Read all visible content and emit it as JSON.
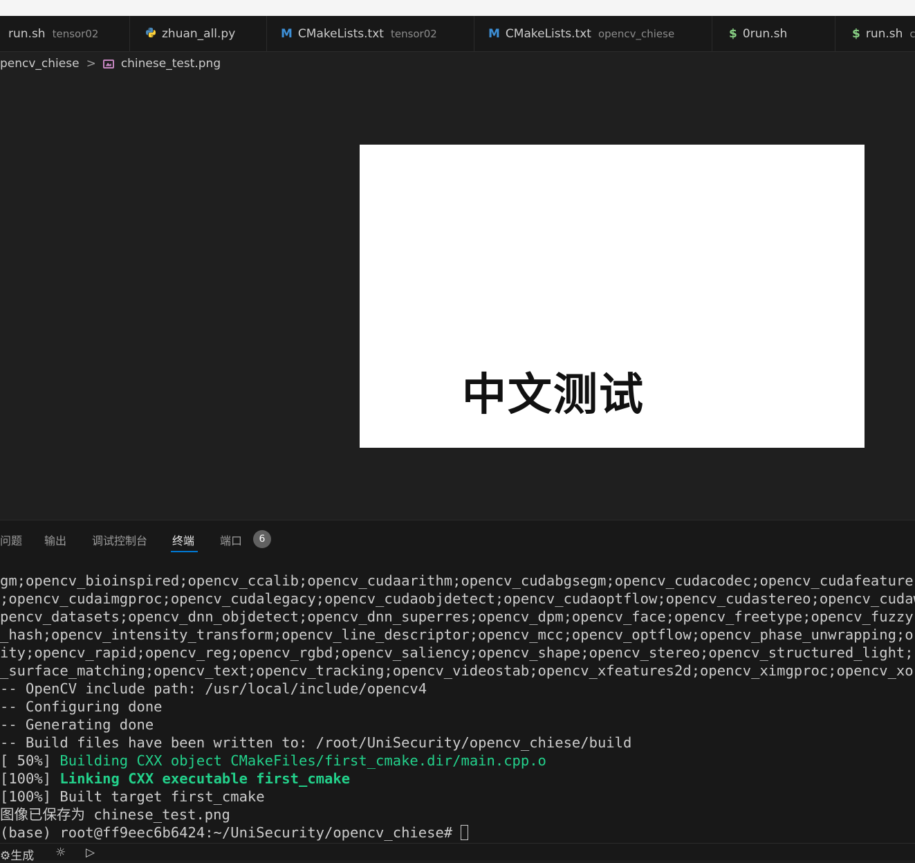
{
  "tabs": [
    {
      "name": "run.sh",
      "desc": "tensor02",
      "icon": "shell-icon"
    },
    {
      "name": "zhuan_all.py",
      "desc": "",
      "icon": "python-icon"
    },
    {
      "name": "CMakeLists.txt",
      "desc": "tensor02",
      "icon": "cmake-icon",
      "glyph": "M"
    },
    {
      "name": "CMakeLists.txt",
      "desc": "opencv_chiese",
      "icon": "cmake-icon",
      "glyph": "M"
    },
    {
      "name": "0run.sh",
      "desc": "",
      "icon": "shell-icon",
      "glyph": "$"
    },
    {
      "name": "run.sh",
      "desc": "c",
      "icon": "shell-icon",
      "glyph": "$"
    }
  ],
  "breadcrumb": {
    "folder": "pencv_chiese",
    "separator": ">",
    "file": "chinese_test.png"
  },
  "preview": {
    "text": "中文测试"
  },
  "panel": {
    "tabs": [
      "问题",
      "输出",
      "调试控制台",
      "终端",
      "端口"
    ],
    "active_tab": "终端",
    "ports_badge": "6"
  },
  "terminal": {
    "lines": [
      "gm;opencv_bioinspired;opencv_ccalib;opencv_cudaarithm;opencv_cudabgsegm;opencv_cudacodec;opencv_cudafeature",
      ";opencv_cudaimgproc;opencv_cudalegacy;opencv_cudaobjdetect;opencv_cudaoptflow;opencv_cudastereo;opencv_cudaw",
      "pencv_datasets;opencv_dnn_objdetect;opencv_dnn_superres;opencv_dpm;opencv_face;opencv_freetype;opencv_fuzzy",
      "_hash;opencv_intensity_transform;opencv_line_descriptor;opencv_mcc;opencv_optflow;opencv_phase_unwrapping;o",
      "ity;opencv_rapid;opencv_reg;opencv_rgbd;opencv_saliency;opencv_shape;opencv_stereo;opencv_structured_light;",
      "_surface_matching;opencv_text;opencv_tracking;opencv_videostab;opencv_xfeatures2d;opencv_ximgproc;opencv_xo",
      "-- OpenCV include path: /usr/local/include/opencv4",
      "-- Configuring done",
      "-- Generating done",
      "-- Build files have been written to: /root/UniSecurity/opencv_chiese/build"
    ],
    "build_line_prefix": "[ 50%] ",
    "build_line_text": "Building CXX object CMakeFiles/first_cmake.dir/main.cpp.o",
    "link_line_prefix": "[100%] ",
    "link_line_text": "Linking CXX executable first_cmake",
    "built_line": "[100%] Built target first_cmake",
    "saved_line": "图像已保存为 chinese_test.png",
    "prompt": "(base) root@ff9eec6b6424:~/UniSecurity/opencv_chiese# "
  },
  "statusbar": {
    "build_label": "生成",
    "build_icon": "gear-icon",
    "debug_icon": "bug-icon",
    "run_icon": "play-icon"
  },
  "colors": {
    "accent": "#0078d4",
    "terminal_green": "#23d18b",
    "cmake_icon": "#3d8fd6",
    "shell_icon": "#89d185"
  }
}
